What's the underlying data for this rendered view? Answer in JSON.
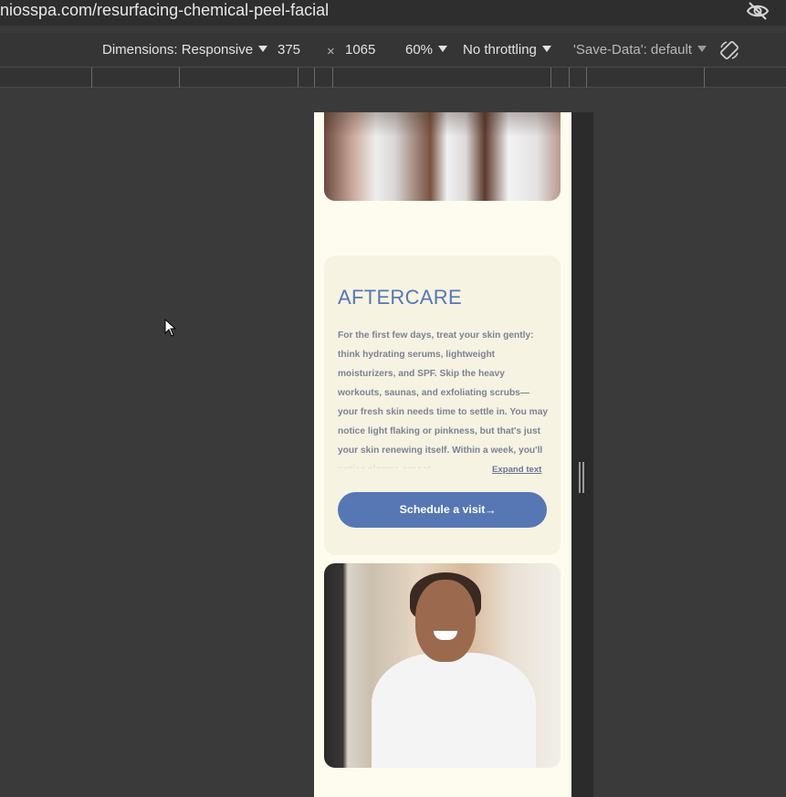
{
  "browser": {
    "url": "niosspa.com/resurfacing-chemical-peel-facial"
  },
  "device_toolbar": {
    "dimensions_label": "Dimensions: Responsive",
    "width": "375",
    "times": "×",
    "height": "1065",
    "zoom": "60%",
    "throttling": "No throttling",
    "save_data": "'Save-Data': default"
  },
  "page": {
    "aftercare": {
      "heading": "AFTERCARE",
      "body": "For the first few days, treat your skin gently: think hydrating serums, lightweight moisturizers, and SPF. Skip the heavy workouts, saunas, and exfoliating scrubs—your fresh skin needs time to settle in. You may notice light flaking or pinkness, but that's just your skin renewing itself. Within a week, you'll notice clearer, smoot",
      "expand_label": "Expand text",
      "cta_label": "Schedule a visit",
      "cta_arrow": "→"
    }
  },
  "colors": {
    "accent": "#5677b4",
    "page_bg": "#fdfcee",
    "card_bg": "#f6f3e2"
  }
}
